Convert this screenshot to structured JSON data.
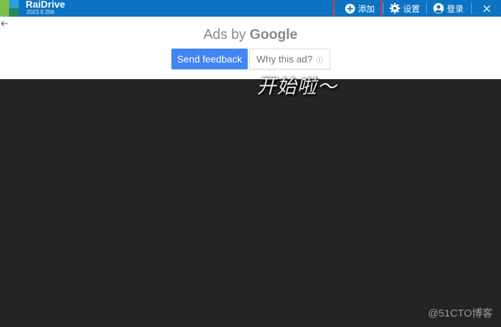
{
  "titlebar": {
    "app_name": "RaiDrive",
    "version": "2023.9.256",
    "add_label": "添加",
    "settings_label": "设置",
    "login_label": "登录",
    "background": "#0b73c2"
  },
  "ad": {
    "ads_by": "Ads by",
    "google": "Google",
    "send_feedback": "Send feedback",
    "why_this_ad": "Why this ad?",
    "info_icon": "ⓘ",
    "button_color": "#4285f4"
  },
  "main": {
    "start_text": "开始啦～",
    "watermark": "@51CTO博客",
    "background": "#242424"
  },
  "icons": [
    "plus-circle-icon",
    "gear-icon",
    "user-icon",
    "close-icon",
    "back-arrow-icon"
  ]
}
